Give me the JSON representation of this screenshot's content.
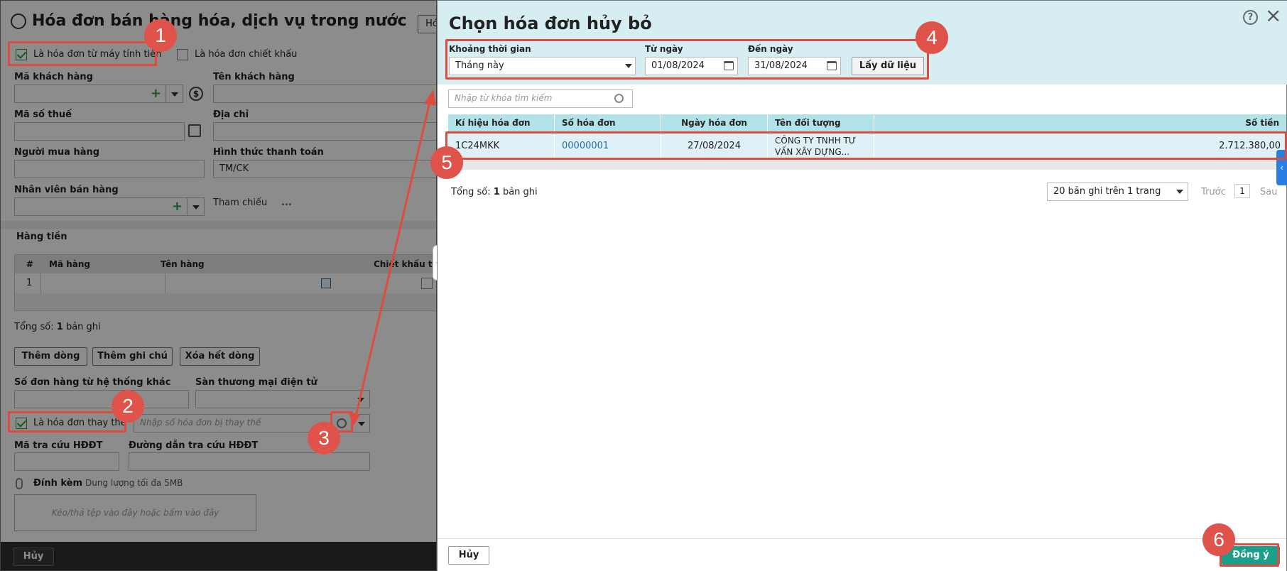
{
  "left": {
    "title": "Hóa đơn bán hàng hóa, dịch vụ trong nước",
    "title_btn": "Hó",
    "cb_machine": "Là hóa đơn từ máy tính tiền",
    "cb_discount": "Là hóa đơn chiết khấu",
    "lbl_customer_code": "Mã khách hàng",
    "lbl_customer_name": "Tên khách hàng",
    "lbl_tax": "Mã số thuế",
    "lbl_address": "Địa chỉ",
    "lbl_buyer": "Người mua hàng",
    "lbl_payment": "Hình thức thanh toán",
    "payment_value": "TM/CK",
    "lbl_staff": "Nhân viên bán hàng",
    "lbl_ref": "Tham chiếu",
    "ref_link": "...",
    "section": "Hàng tiền",
    "cols": [
      "#",
      "Mã hàng",
      "Tên hàng",
      "Chiết khấu thư"
    ],
    "row_no": "1",
    "total_prefix": "Tổng số: ",
    "total_count": "1",
    "total_suffix": " bản ghi",
    "btn_add_row": "Thêm dòng",
    "btn_add_note": "Thêm ghi chú",
    "btn_delete": "Xóa hết dòng",
    "lbl_order": "Số đơn hàng từ hệ thống khác",
    "lbl_ecom": "Sàn thương mại điện tử",
    "cb_replace": "Là hóa đơn thay thế",
    "replace_placeholder": "Nhập số hóa đơn bị thay thế",
    "lbl_lookup": "Mã tra cứu HĐĐT",
    "lbl_lookup_link": "Đường dẫn tra cứu HĐĐT",
    "lbl_attach": "Đính kèm",
    "attach_hint": "Dung lượng tối đa 5MB",
    "drop_hint": "Kéo/thả tệp vào đây hoặc bấm vào đây",
    "btn_cancel": "Hủy"
  },
  "dialog": {
    "title": "Chọn hóa đơn hủy bỏ",
    "lbl_period": "Khoảng thời gian",
    "period_value": "Tháng này",
    "lbl_from": "Từ ngày",
    "from_value": "01/08/2024",
    "lbl_to": "Đến ngày",
    "to_value": "31/08/2024",
    "btn_load": "Lấy dữ liệu",
    "search_placeholder": "Nhập từ khóa tìm kiếm",
    "cols": [
      "Kí hiệu hóa đơn",
      "Số hóa đơn",
      "Ngày hóa đơn",
      "Tên đối tượng",
      "Số tiền"
    ],
    "row": {
      "symbol": "1C24MKK",
      "number": "00000001",
      "date": "27/08/2024",
      "name_line1": "CÔNG TY TNHH TƯ",
      "name_line2": "VẤN XÂY DỰNG...",
      "amount": "2.712.380,00"
    },
    "total_prefix": "Tổng số: ",
    "total_count": "1",
    "total_suffix": " bản ghi",
    "page_size": "20 bản ghi trên 1 trang",
    "prev": "Trước",
    "page": "1",
    "next": "Sau",
    "btn_cancel": "Hủy",
    "btn_ok": "Đồng ý"
  },
  "badges": [
    "1",
    "2",
    "3",
    "4",
    "5",
    "6"
  ],
  "colors": {
    "accent": "#2a9d40",
    "annotation": "#e04b3f",
    "header": "#b3e3ea",
    "ok": "#1aa08a"
  }
}
